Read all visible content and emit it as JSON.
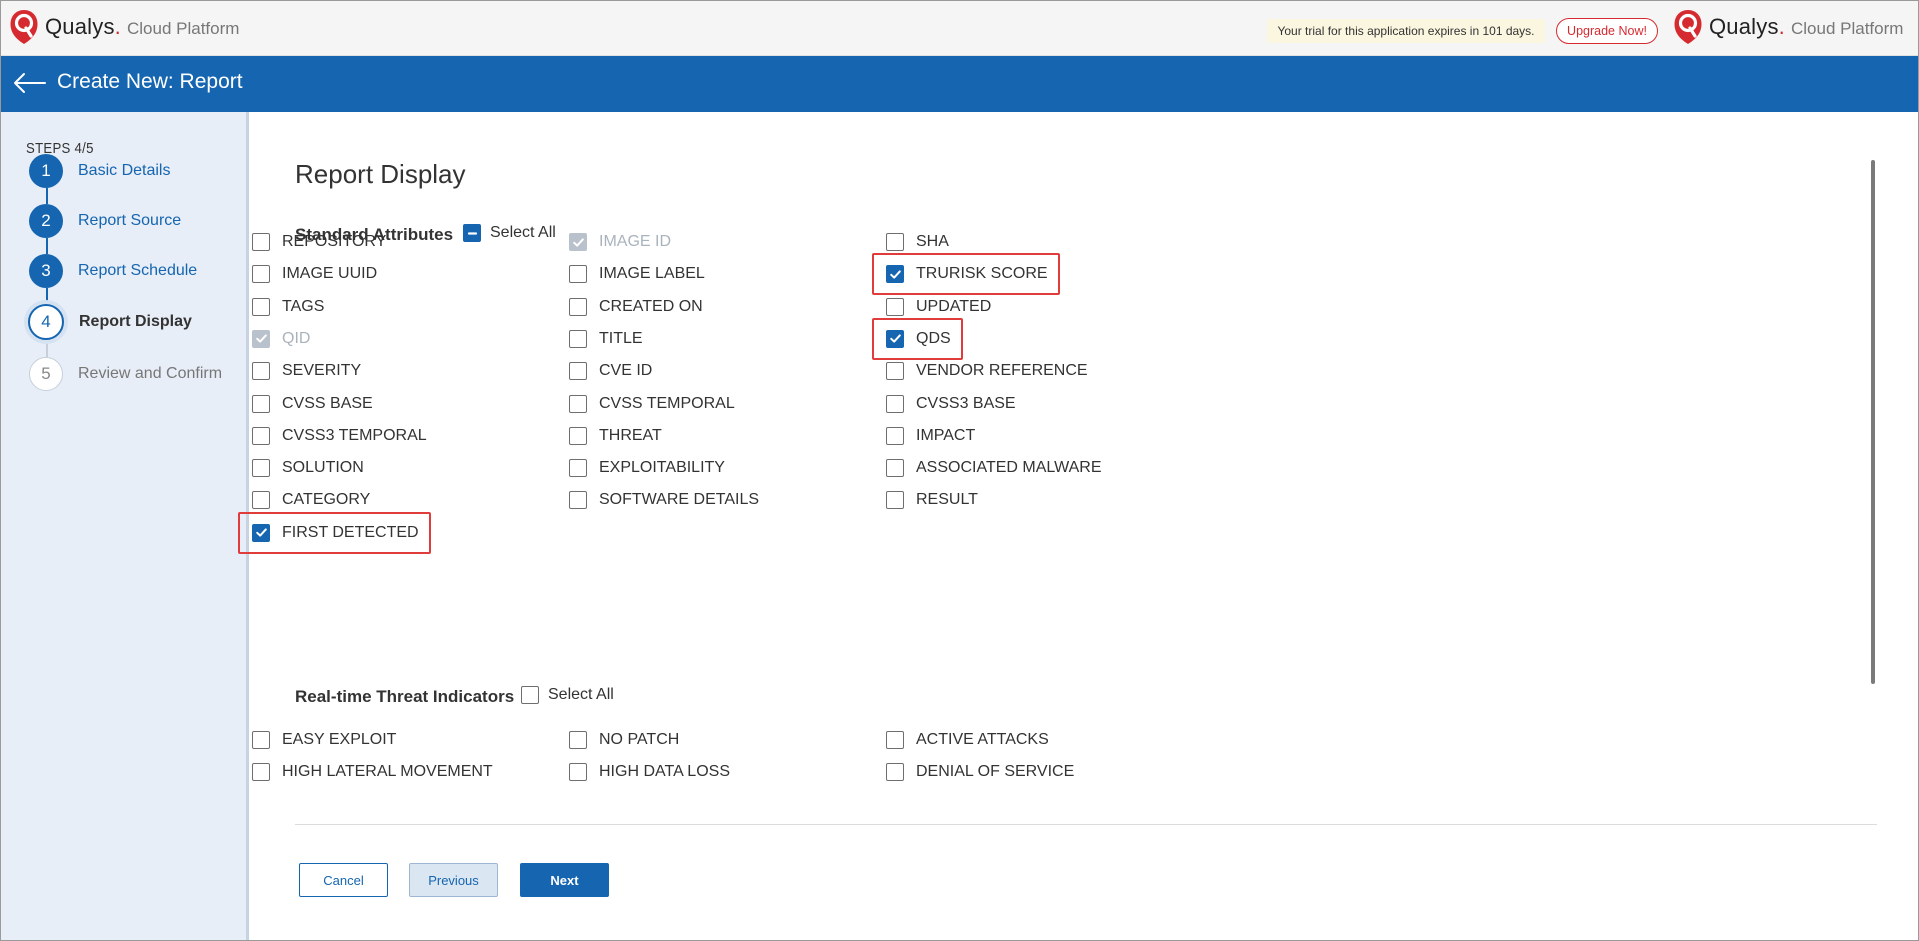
{
  "header": {
    "brand": "Qualys",
    "product": "Cloud Platform",
    "trial_message": "Your trial for this application expires in 101 days.",
    "upgrade_label": "Upgrade Now!"
  },
  "titlebar": {
    "title": "Create New: Report"
  },
  "sidebar": {
    "steps_count": "STEPS 4/5",
    "steps": [
      {
        "number": "1",
        "label": "Basic Details",
        "state": "done"
      },
      {
        "number": "2",
        "label": "Report Source",
        "state": "done"
      },
      {
        "number": "3",
        "label": "Report Schedule",
        "state": "done"
      },
      {
        "number": "4",
        "label": "Report Display",
        "state": "current"
      },
      {
        "number": "5",
        "label": "Review and Confirm",
        "state": "pending"
      }
    ]
  },
  "main": {
    "heading": "Report Display",
    "standard": {
      "title": "Standard Attributes",
      "select_all": "Select All",
      "select_all_state": "indeterminate",
      "options": [
        {
          "label": "REPOSITORY",
          "checked": false,
          "disabled": false,
          "highlighted": false
        },
        {
          "label": "IMAGE ID",
          "checked": true,
          "disabled": true,
          "highlighted": false
        },
        {
          "label": "SHA",
          "checked": false,
          "disabled": false,
          "highlighted": false
        },
        {
          "label": "IMAGE UUID",
          "checked": false,
          "disabled": false,
          "highlighted": false
        },
        {
          "label": "IMAGE LABEL",
          "checked": false,
          "disabled": false,
          "highlighted": false
        },
        {
          "label": "TRURISK SCORE",
          "checked": true,
          "disabled": false,
          "highlighted": true
        },
        {
          "label": "TAGS",
          "checked": false,
          "disabled": false,
          "highlighted": false
        },
        {
          "label": "CREATED ON",
          "checked": false,
          "disabled": false,
          "highlighted": false
        },
        {
          "label": "UPDATED",
          "checked": false,
          "disabled": false,
          "highlighted": false
        },
        {
          "label": "QID",
          "checked": true,
          "disabled": true,
          "highlighted": false
        },
        {
          "label": "TITLE",
          "checked": false,
          "disabled": false,
          "highlighted": false
        },
        {
          "label": "QDS",
          "checked": true,
          "disabled": false,
          "highlighted": true
        },
        {
          "label": "SEVERITY",
          "checked": false,
          "disabled": false,
          "highlighted": false
        },
        {
          "label": "CVE ID",
          "checked": false,
          "disabled": false,
          "highlighted": false
        },
        {
          "label": "VENDOR REFERENCE",
          "checked": false,
          "disabled": false,
          "highlighted": false
        },
        {
          "label": "CVSS BASE",
          "checked": false,
          "disabled": false,
          "highlighted": false
        },
        {
          "label": "CVSS TEMPORAL",
          "checked": false,
          "disabled": false,
          "highlighted": false
        },
        {
          "label": "CVSS3 BASE",
          "checked": false,
          "disabled": false,
          "highlighted": false
        },
        {
          "label": "CVSS3 TEMPORAL",
          "checked": false,
          "disabled": false,
          "highlighted": false
        },
        {
          "label": "THREAT",
          "checked": false,
          "disabled": false,
          "highlighted": false
        },
        {
          "label": "IMPACT",
          "checked": false,
          "disabled": false,
          "highlighted": false
        },
        {
          "label": "SOLUTION",
          "checked": false,
          "disabled": false,
          "highlighted": false
        },
        {
          "label": "EXPLOITABILITY",
          "checked": false,
          "disabled": false,
          "highlighted": false
        },
        {
          "label": "ASSOCIATED MALWARE",
          "checked": false,
          "disabled": false,
          "highlighted": false
        },
        {
          "label": "CATEGORY",
          "checked": false,
          "disabled": false,
          "highlighted": false
        },
        {
          "label": "SOFTWARE DETAILS",
          "checked": false,
          "disabled": false,
          "highlighted": false
        },
        {
          "label": "RESULT",
          "checked": false,
          "disabled": false,
          "highlighted": false
        },
        {
          "label": "FIRST DETECTED",
          "checked": true,
          "disabled": false,
          "highlighted": true
        }
      ]
    },
    "threat": {
      "title": "Real-time Threat Indicators",
      "select_all": "Select All",
      "select_all_state": "unchecked",
      "options": [
        {
          "label": "EASY EXPLOIT",
          "checked": false,
          "disabled": false,
          "highlighted": false
        },
        {
          "label": "NO PATCH",
          "checked": false,
          "disabled": false,
          "highlighted": false
        },
        {
          "label": "ACTIVE ATTACKS",
          "checked": false,
          "disabled": false,
          "highlighted": false
        },
        {
          "label": "HIGH LATERAL MOVEMENT",
          "checked": false,
          "disabled": false,
          "highlighted": false
        },
        {
          "label": "HIGH DATA LOSS",
          "checked": false,
          "disabled": false,
          "highlighted": false
        },
        {
          "label": "DENIAL OF SERVICE",
          "checked": false,
          "disabled": false,
          "highlighted": false
        }
      ]
    },
    "buttons": {
      "cancel": "Cancel",
      "previous": "Previous",
      "next": "Next"
    }
  },
  "colors": {
    "primary": "#1565b0",
    "highlight": "#e13c3c",
    "brand_red": "#d52b30"
  }
}
